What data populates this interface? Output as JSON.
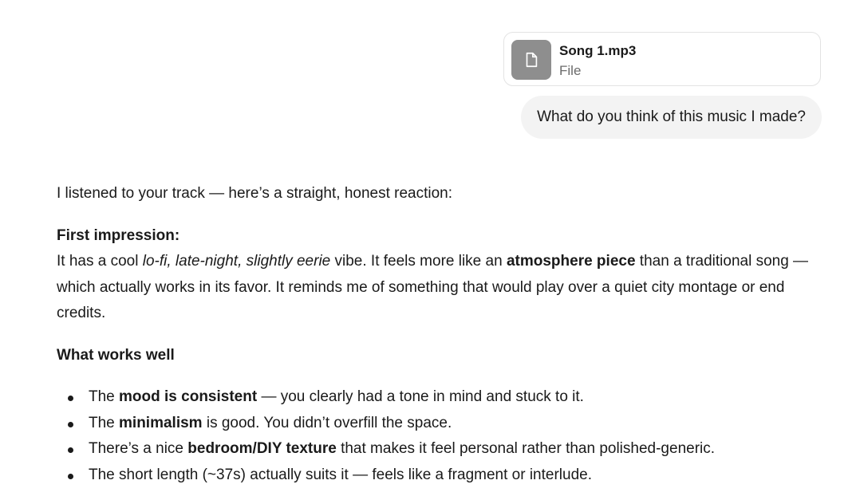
{
  "attachment": {
    "file_name": "Song 1.mp3",
    "file_type": "File",
    "icon": "document-icon",
    "icon_bg": "#8e8e8e"
  },
  "user_message": {
    "text": "What do you think of this music I made?",
    "bubble_bg": "#f3f3f3"
  },
  "assistant": {
    "intro": "I listened to your track — here’s a straight, honest reaction:",
    "first_impression": {
      "heading": "First impression:",
      "s1": "It has a cool ",
      "s2_italic": "lo-fi, late-night, slightly eerie",
      "s3": " vibe. It feels more like an ",
      "s4_bold": "atmosphere piece",
      "s5": " than a traditional song — which actually works in its favor. It reminds me of something that would play over a quiet city montage or end credits."
    },
    "works_well": {
      "heading": "What works well",
      "items": [
        {
          "pre": "The ",
          "bold": "mood is consistent",
          "post": " — you clearly had a tone in mind and stuck to it."
        },
        {
          "pre": "The ",
          "bold": "minimalism",
          "post": " is good. You didn’t overfill the space."
        },
        {
          "pre": "There’s a nice ",
          "bold": "bedroom/DIY texture",
          "post": " that makes it feel personal rather than polished-generic."
        },
        {
          "pre": "The short length (~37s) actually suits it — feels like a fragment or interlude.",
          "bold": "",
          "post": ""
        }
      ]
    }
  }
}
